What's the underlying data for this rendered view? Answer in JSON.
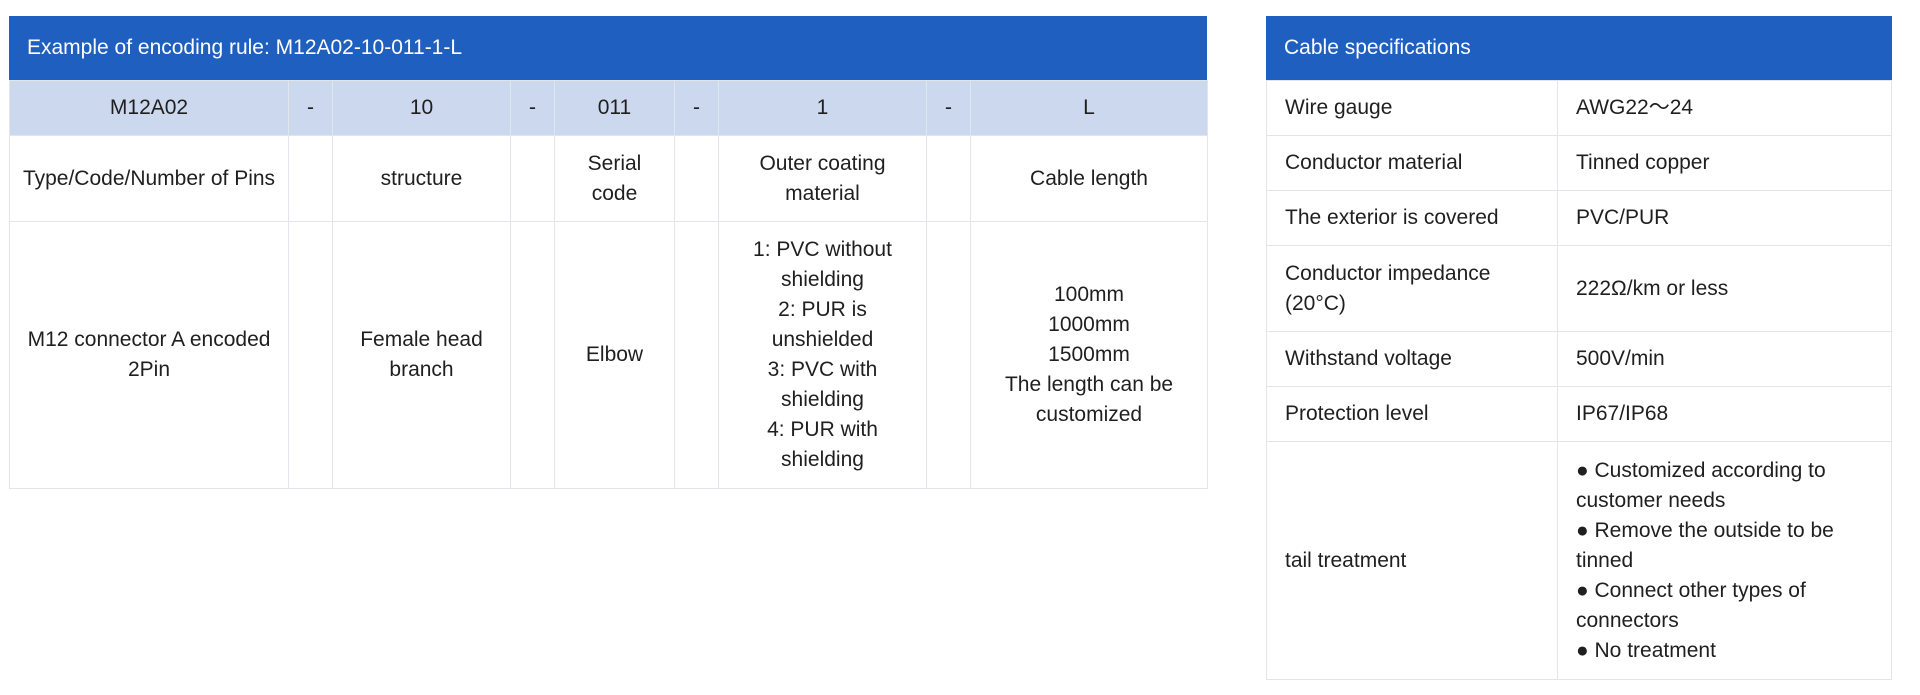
{
  "encoding": {
    "title": "Example of encoding rule: M12A02-10-011-1-L",
    "codes": [
      "M12A02",
      "-",
      "10",
      "-",
      "011",
      "-",
      "1",
      "-",
      "L"
    ],
    "labels": [
      "Type/Code/Number of Pins",
      "structure",
      "Serial code",
      "Outer coating material",
      "Cable length"
    ],
    "descriptions": {
      "type": "M12 connector A encoded 2Pin",
      "structure": "Female head branch",
      "serial": "Elbow",
      "coating": [
        "1: PVC without shielding",
        "2: PUR is unshielded",
        "3: PVC with shielding",
        "4: PUR with shielding"
      ],
      "length": [
        "100mm",
        "1000mm",
        "1500mm",
        "The length can be customized"
      ]
    }
  },
  "specs": {
    "title": "Cable specifications",
    "rows": [
      {
        "key": "Wire gauge",
        "value": "AWG22～24"
      },
      {
        "key": "Conductor material",
        "value": "Tinned copper"
      },
      {
        "key": "The exterior is covered",
        "value": "PVC/PUR"
      },
      {
        "key": "Conductor impedance (20°C)",
        "value": "222Ω/km or less"
      },
      {
        "key": "Withstand voltage",
        "value": "500V/min"
      },
      {
        "key": "Protection level",
        "value": "IP67/IP68"
      }
    ],
    "tail": {
      "key": "tail treatment",
      "items": [
        "● Customized according to customer needs",
        "● Remove the outside to be tinned",
        "● Connect other types of connectors",
        "● No treatment"
      ]
    }
  },
  "colors": {
    "header_bg": "#1f5fbf",
    "code_row_bg": "#ccd8ee",
    "border": "#e2e5ea"
  }
}
